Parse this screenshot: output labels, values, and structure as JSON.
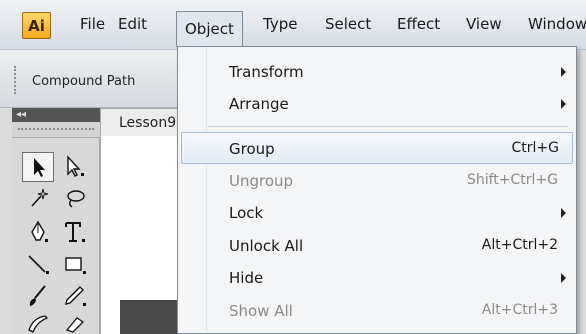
{
  "app": {
    "logo_text": "Ai"
  },
  "menubar": {
    "items": [
      {
        "label": "File"
      },
      {
        "label": "Edit"
      },
      {
        "label": "Object"
      },
      {
        "label": "Type"
      },
      {
        "label": "Select"
      },
      {
        "label": "Effect"
      },
      {
        "label": "View"
      },
      {
        "label": "Window"
      }
    ],
    "active": "Object"
  },
  "controlbar": {
    "compound_label": "Compound Path"
  },
  "tools_panel": {
    "collapse_glyph": "◂◂"
  },
  "document": {
    "tab_label": "Lesson9"
  },
  "object_menu": {
    "items": [
      {
        "label": "Transform",
        "shortcut": "",
        "submenu": true,
        "enabled": true
      },
      {
        "label": "Arrange",
        "shortcut": "",
        "submenu": true,
        "enabled": true
      },
      {
        "label": "Group",
        "shortcut": "Ctrl+G",
        "submenu": false,
        "enabled": true,
        "highlighted": true
      },
      {
        "label": "Ungroup",
        "shortcut": "Shift+Ctrl+G",
        "submenu": false,
        "enabled": false
      },
      {
        "label": "Lock",
        "shortcut": "",
        "submenu": true,
        "enabled": true
      },
      {
        "label": "Unlock All",
        "shortcut": "Alt+Ctrl+2",
        "submenu": false,
        "enabled": true
      },
      {
        "label": "Hide",
        "shortcut": "",
        "submenu": true,
        "enabled": true
      },
      {
        "label": "Show All",
        "shortcut": "Alt+Ctrl+3",
        "submenu": false,
        "enabled": false
      }
    ]
  },
  "icons": {
    "selection": "selection-tool-icon",
    "direct_selection": "direct-selection-tool-icon",
    "magic_wand": "magic-wand-tool-icon",
    "lasso": "lasso-tool-icon",
    "pen": "pen-tool-icon",
    "type": "type-tool-icon",
    "line": "line-segment-tool-icon",
    "rectangle": "rectangle-tool-icon",
    "paintbrush": "paintbrush-tool-icon",
    "pencil": "pencil-tool-icon",
    "blob_brush": "blob-brush-tool-icon",
    "eraser": "eraser-tool-icon"
  },
  "colors": {
    "menu_highlight_border": "#a8bcd6",
    "logo_fill": "#f3a91e",
    "disabled_text": "#8a8a8a"
  }
}
